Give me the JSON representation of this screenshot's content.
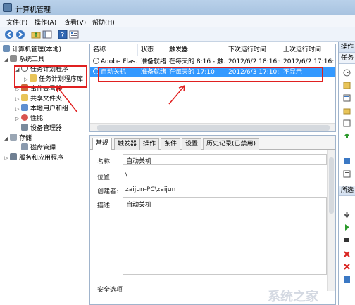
{
  "window": {
    "title": "计算机管理"
  },
  "menu": [
    "文件(F)",
    "操作(A)",
    "查看(V)",
    "帮助(H)"
  ],
  "tree": {
    "root": "计算机管理(本地)",
    "system_tools": "系统工具",
    "task_scheduler": "任务计划程序",
    "task_library": "任务计划程序库",
    "event_viewer": "事件查看器",
    "shared_folders": "共享文件夹",
    "local_users": "本地用户和组",
    "performance": "性能",
    "device_manager": "设备管理器",
    "storage": "存储",
    "disk_management": "磁盘管理",
    "services": "服务和应用程序"
  },
  "task_list": {
    "columns": [
      "名称",
      "状态",
      "触发器",
      "下次运行时间",
      "上次运行时间"
    ],
    "rows": [
      {
        "name": "Adobe Flas...",
        "status": "准备就绪",
        "trigger": "在每天的 8:16 - 触...",
        "next_run": "2012/6/2 18:16:00",
        "last_run": "2012/6/2 17:16:",
        "selected": false
      },
      {
        "name": "自动关机",
        "status": "准备就绪",
        "trigger": "在每天的 17:10",
        "next_run": "2012/6/3 17:10:58",
        "last_run": "不显示",
        "selected": true
      }
    ]
  },
  "details": {
    "tabs": [
      "常规",
      "触发器",
      "操作",
      "条件",
      "设置",
      "历史记录(已禁用)"
    ],
    "active_tab": "常规",
    "name_label": "名称:",
    "name_value": "自动关机",
    "location_label": "位置:",
    "location_value": "\\",
    "author_label": "创建者:",
    "author_value": "zaijun-PC\\zaijun",
    "description_label": "描述:",
    "description_value": "自动关机",
    "security_label": "安全选项"
  },
  "actions": {
    "header": "操作",
    "subheader": "任务",
    "selected_header": "所选"
  },
  "watermark_text": "系统之家"
}
